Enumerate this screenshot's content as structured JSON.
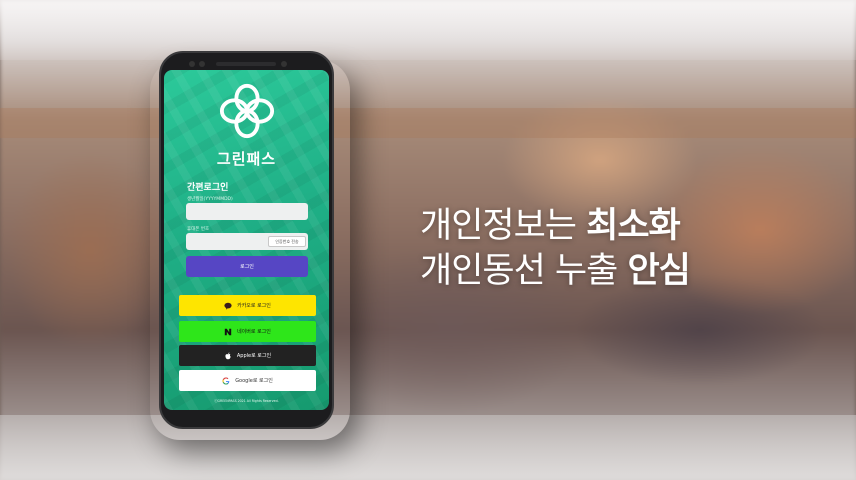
{
  "app": {
    "name": "그린패스",
    "section_title": "간편로그인",
    "birth_label": "생년월일(YYYYMMDD)",
    "birth_value": "",
    "phone_label": "휴대폰 번호",
    "phone_value": "",
    "cert_button": "인증번호 전송",
    "login_button": "로그인",
    "social": {
      "kakao": "카카오로 로그인",
      "naver": "네이버로 로그인",
      "apple": "Apple로 로그인",
      "google": "Google로 로그인"
    },
    "footer": "ⓒGREENPASS 2021 All Rights Reserved."
  },
  "headline": {
    "line1_regular": "개인정보는 ",
    "line1_bold": "최소화",
    "line2_regular": "개인동선 누출 ",
    "line2_bold": "안심"
  },
  "colors": {
    "screen_green": "#1faf86",
    "login_purple": "#5646c4",
    "kakao_yellow": "#fee500",
    "naver_green": "#2ee61a",
    "apple_black": "#222222",
    "google_white": "#ffffff"
  },
  "icons": {
    "logo": "clover-icon",
    "kakao": "speech-bubble-icon",
    "naver": "naver-n-icon",
    "apple": "apple-icon",
    "google": "google-g-icon"
  }
}
